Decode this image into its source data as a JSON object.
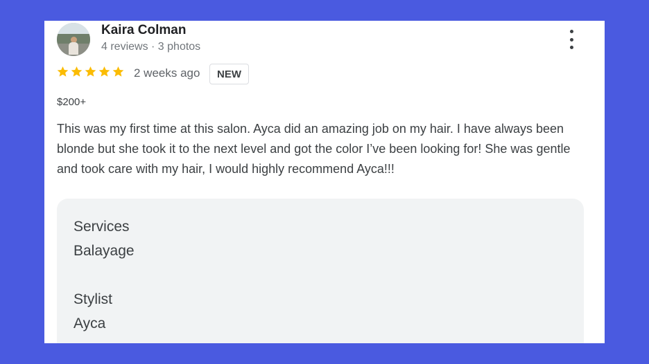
{
  "review": {
    "author": "Kaira Colman",
    "meta": "4 reviews · 3 photos",
    "rating": 5,
    "max_rating": 5,
    "time_ago": "2 weeks ago",
    "badge": "NEW",
    "price": "$200+",
    "text": "This was my first time at this salon. Ayca did an amazing job on my hair. I have always been blonde but she took it to the next level and got the color I’ve been looking for! She was gentle and took care with my hair, I would highly recommend Ayca!!!"
  },
  "details": {
    "services_label": "Services",
    "services_value": "Balayage",
    "stylist_label": "Stylist",
    "stylist_value": "Ayca"
  },
  "colors": {
    "background": "#4a5ae0",
    "star": "#fbbc04"
  },
  "icons": {
    "avatar": "profile-photo",
    "more": "vertical-dots-icon",
    "stars": "star-icon"
  }
}
